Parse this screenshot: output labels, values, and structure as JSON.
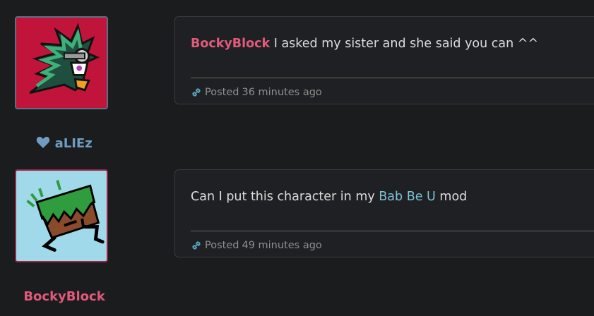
{
  "posts": [
    {
      "mention": "BockyBlock",
      "message": " I asked my sister and she said you can ^^",
      "posted_label": "Posted",
      "time": "36 minutes ago",
      "user": {
        "name": "aLIEz",
        "name_color": "#6f9cc0",
        "has_heart": true,
        "avatar_bg": "#c1143a",
        "avatar_border": "#5e6f86"
      }
    },
    {
      "message_prefix": "Can I put this character in my ",
      "message_link": "Bab Be U",
      "message_suffix": " mod",
      "posted_label": "Posted",
      "time": "49 minutes ago",
      "user": {
        "name": "BockyBlock",
        "name_color": "#e05a7a",
        "has_heart": false,
        "avatar_bg": "#9fd9ea",
        "avatar_border": "#9b2443"
      }
    }
  ],
  "icons": {
    "heart": "heart-icon",
    "link": "link-icon"
  }
}
